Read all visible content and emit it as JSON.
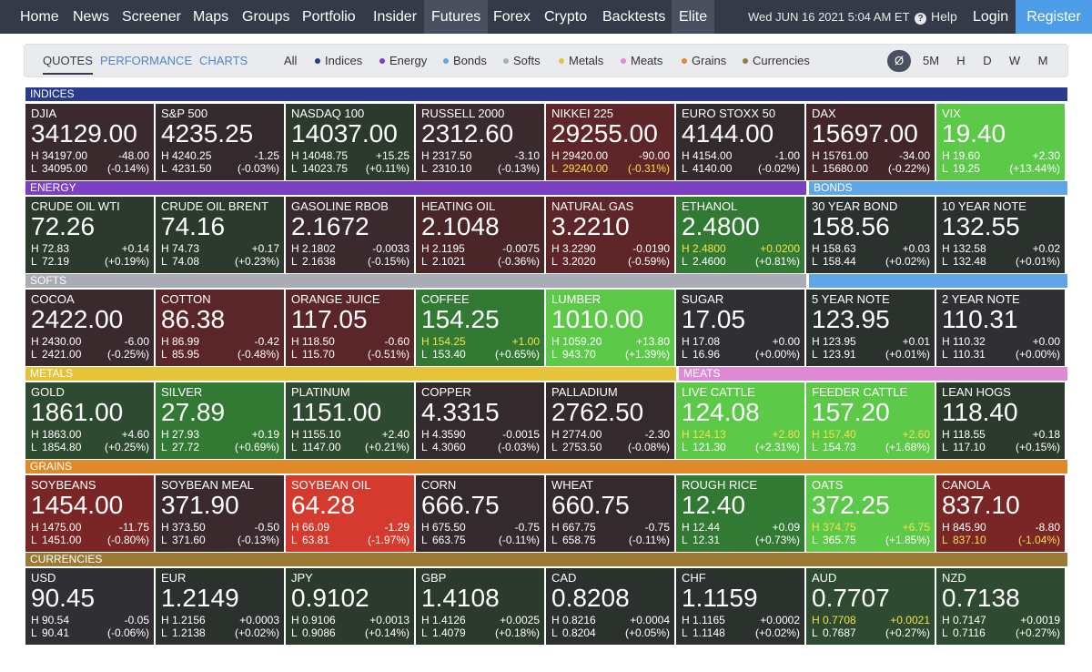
{
  "nav": {
    "items": [
      "Home",
      "News",
      "Screener",
      "Maps",
      "Groups",
      "Portfolio",
      "Insider",
      "Futures",
      "Forex",
      "Crypto",
      "Backtests",
      "Elite"
    ],
    "active": "Futures",
    "datetime": "Wed JUN 16 2021 5:04 AM ET",
    "help": "Help",
    "login": "Login",
    "register": "Register"
  },
  "subnav": {
    "tabs": [
      "QUOTES",
      "PERFORMANCE",
      "CHARTS"
    ],
    "active_tab": "QUOTES",
    "filters": [
      {
        "label": "All",
        "color": ""
      },
      {
        "label": "Indices",
        "color": "#2a3a8c"
      },
      {
        "label": "Energy",
        "color": "#7b3fc4"
      },
      {
        "label": "Bonds",
        "color": "#5ea6e8"
      },
      {
        "label": "Softs",
        "color": "#a9acb4"
      },
      {
        "label": "Metals",
        "color": "#e6c43a"
      },
      {
        "label": "Meats",
        "color": "#e08ad6"
      },
      {
        "label": "Grains",
        "color": "#e0892a"
      },
      {
        "label": "Currencies",
        "color": "#9a7a35"
      }
    ],
    "periods": [
      "Ø",
      "5M",
      "H",
      "D",
      "W",
      "M"
    ],
    "active_period": "Ø"
  },
  "sections": {
    "indices": {
      "label": "INDICES",
      "color": "#2a3a8c"
    },
    "energy": {
      "label": "ENERGY",
      "color": "#7b3fc4"
    },
    "bonds": {
      "label": "BONDS",
      "color": "#5ea6e8"
    },
    "softs": {
      "label": "SOFTS",
      "color": "#a9acb4"
    },
    "softs_bonds": {
      "label": "",
      "color": "#5ea6e8"
    },
    "metals": {
      "label": "METALS",
      "color": "#e6c43a"
    },
    "meats": {
      "label": "MEATS",
      "color": "#e08ad6"
    },
    "grains": {
      "label": "GRAINS",
      "color": "#e0892a"
    },
    "currencies": {
      "label": "CURRENCIES",
      "color": "#9a7a35"
    }
  },
  "tiles": [
    {
      "name": "DJIA",
      "price": "34129.00",
      "high": "34197.00",
      "low": "34095.00",
      "change": "-48.00",
      "pct": "(-0.14%)",
      "bg": "#3a2a2d",
      "hi": ""
    },
    {
      "name": "S&P 500",
      "price": "4235.25",
      "high": "4240.25",
      "low": "4231.50",
      "change": "-1.25",
      "pct": "(-0.03%)",
      "bg": "#34292d",
      "hi": ""
    },
    {
      "name": "NASDAQ 100",
      "price": "14037.00",
      "high": "14048.75",
      "low": "14023.75",
      "change": "+15.25",
      "pct": "(+0.11%)",
      "bg": "#2c3a2e",
      "hi": ""
    },
    {
      "name": "RUSSELL 2000",
      "price": "2312.60",
      "high": "2317.50",
      "low": "2310.10",
      "change": "-3.10",
      "pct": "(-0.13%)",
      "bg": "#3a2a2d",
      "hi": ""
    },
    {
      "name": "NIKKEI 225",
      "price": "29255.00",
      "high": "29420.00",
      "low": "29240.00",
      "change": "-90.00",
      "pct": "(-0.31%)",
      "bg": "#5e2628",
      "hi": "low"
    },
    {
      "name": "EURO STOXX 50",
      "price": "4144.00",
      "high": "4154.00",
      "low": "4140.00",
      "change": "-1.00",
      "pct": "(-0.02%)",
      "bg": "#322a2d",
      "hi": ""
    },
    {
      "name": "DAX",
      "price": "15697.00",
      "high": "15761.00",
      "low": "15680.00",
      "change": "-34.00",
      "pct": "(-0.22%)",
      "bg": "#422629",
      "hi": ""
    },
    {
      "name": "VIX",
      "price": "19.40",
      "high": "19.60",
      "low": "19.25",
      "change": "+2.30",
      "pct": "(+13.44%)",
      "bg": "#5cc949",
      "hi": ""
    },
    {
      "name": "CRUDE OIL WTI",
      "price": "72.26",
      "high": "72.83",
      "low": "72.19",
      "change": "+0.14",
      "pct": "(+0.19%)",
      "bg": "#2c3a2e",
      "hi": ""
    },
    {
      "name": "CRUDE OIL BRENT",
      "price": "74.16",
      "high": "74.73",
      "low": "74.08",
      "change": "+0.17",
      "pct": "(+0.23%)",
      "bg": "#2c3a2e",
      "hi": ""
    },
    {
      "name": "GASOLINE RBOB",
      "price": "2.1672",
      "high": "2.1802",
      "low": "2.1638",
      "change": "-0.0033",
      "pct": "(-0.15%)",
      "bg": "#3a2a2d",
      "hi": ""
    },
    {
      "name": "HEATING OIL",
      "price": "2.1048",
      "high": "2.1195",
      "low": "2.1021",
      "change": "-0.0075",
      "pct": "(-0.36%)",
      "bg": "#4a2629",
      "hi": ""
    },
    {
      "name": "NATURAL GAS",
      "price": "3.2210",
      "high": "3.2290",
      "low": "3.2020",
      "change": "-0.0190",
      "pct": "(-0.59%)",
      "bg": "#5e2628",
      "hi": ""
    },
    {
      "name": "ETHANOL",
      "price": "2.4800",
      "high": "2.4800",
      "low": "2.4600",
      "change": "+0.0200",
      "pct": "(+0.81%)",
      "bg": "#327a33",
      "hi": "high"
    },
    {
      "name": "30 YEAR BOND",
      "price": "158.56",
      "high": "158.63",
      "low": "158.44",
      "change": "+0.03",
      "pct": "(+0.02%)",
      "bg": "#2b312d",
      "hi": ""
    },
    {
      "name": "10 YEAR NOTE",
      "price": "132.55",
      "high": "132.58",
      "low": "132.48",
      "change": "+0.02",
      "pct": "(+0.01%)",
      "bg": "#2b312d",
      "hi": ""
    },
    {
      "name": "COCOA",
      "price": "2422.00",
      "high": "2430.00",
      "low": "2421.00",
      "change": "-6.00",
      "pct": "(-0.25%)",
      "bg": "#3a2a2d",
      "hi": ""
    },
    {
      "name": "COTTON",
      "price": "86.38",
      "high": "86.99",
      "low": "85.95",
      "change": "-0.42",
      "pct": "(-0.48%)",
      "bg": "#5a2629",
      "hi": ""
    },
    {
      "name": "ORANGE JUICE",
      "price": "117.05",
      "high": "118.50",
      "low": "115.70",
      "change": "-0.60",
      "pct": "(-0.51%)",
      "bg": "#5a2629",
      "hi": ""
    },
    {
      "name": "COFFEE",
      "price": "154.25",
      "high": "154.25",
      "low": "153.40",
      "change": "+1.00",
      "pct": "(+0.65%)",
      "bg": "#327a33",
      "hi": "high"
    },
    {
      "name": "LUMBER",
      "price": "1010.00",
      "high": "1059.20",
      "low": "943.70",
      "change": "+13.80",
      "pct": "(+1.39%)",
      "bg": "#5cc949",
      "hi": ""
    },
    {
      "name": "SUGAR",
      "price": "17.05",
      "high": "17.08",
      "low": "16.96",
      "change": "+0.00",
      "pct": "(+0.00%)",
      "bg": "#303034",
      "hi": ""
    },
    {
      "name": "5 YEAR NOTE",
      "price": "123.95",
      "high": "123.95",
      "low": "123.91",
      "change": "+0.01",
      "pct": "(+0.01%)",
      "bg": "#2b312d",
      "hi": ""
    },
    {
      "name": "2 YEAR NOTE",
      "price": "110.31",
      "high": "110.32",
      "low": "110.31",
      "change": "+0.00",
      "pct": "(+0.00%)",
      "bg": "#303034",
      "hi": ""
    },
    {
      "name": "GOLD",
      "price": "1861.00",
      "high": "1863.00",
      "low": "1854.80",
      "change": "+4.60",
      "pct": "(+0.25%)",
      "bg": "#2e4a30",
      "hi": ""
    },
    {
      "name": "SILVER",
      "price": "27.89",
      "high": "27.93",
      "low": "27.72",
      "change": "+0.19",
      "pct": "(+0.69%)",
      "bg": "#327a33",
      "hi": ""
    },
    {
      "name": "PLATINUM",
      "price": "1151.00",
      "high": "1155.10",
      "low": "1147.00",
      "change": "+2.40",
      "pct": "(+0.21%)",
      "bg": "#2e4a30",
      "hi": ""
    },
    {
      "name": "COPPER",
      "price": "4.3315",
      "high": "4.3590",
      "low": "4.3060",
      "change": "-0.0015",
      "pct": "(-0.03%)",
      "bg": "#34292d",
      "hi": ""
    },
    {
      "name": "PALLADIUM",
      "price": "2762.50",
      "high": "2774.00",
      "low": "2753.50",
      "change": "-2.30",
      "pct": "(-0.08%)",
      "bg": "#34292d",
      "hi": ""
    },
    {
      "name": "LIVE CATTLE",
      "price": "124.08",
      "high": "124.13",
      "low": "121.30",
      "change": "+2.80",
      "pct": "(+2.31%)",
      "bg": "#5cc949",
      "hi": "high"
    },
    {
      "name": "FEEDER CATTLE",
      "price": "157.20",
      "high": "157.40",
      "low": "154.73",
      "change": "+2.60",
      "pct": "(+1.68%)",
      "bg": "#5cc949",
      "hi": "high"
    },
    {
      "name": "LEAN HOGS",
      "price": "118.40",
      "high": "118.55",
      "low": "117.10",
      "change": "+0.18",
      "pct": "(+0.15%)",
      "bg": "#2c3a2e",
      "hi": ""
    },
    {
      "name": "SOYBEANS",
      "price": "1454.00",
      "high": "1475.00",
      "low": "1451.00",
      "change": "-11.75",
      "pct": "(-0.80%)",
      "bg": "#7a2626",
      "hi": ""
    },
    {
      "name": "SOYBEAN MEAL",
      "price": "371.90",
      "high": "373.50",
      "low": "371.60",
      "change": "-0.50",
      "pct": "(-0.13%)",
      "bg": "#3a2a2d",
      "hi": ""
    },
    {
      "name": "SOYBEAN OIL",
      "price": "64.28",
      "high": "66.09",
      "low": "63.81",
      "change": "-1.29",
      "pct": "(-1.97%)",
      "bg": "#d43a2e",
      "hi": ""
    },
    {
      "name": "CORN",
      "price": "666.75",
      "high": "675.50",
      "low": "663.75",
      "change": "-0.75",
      "pct": "(-0.11%)",
      "bg": "#34292d",
      "hi": ""
    },
    {
      "name": "WHEAT",
      "price": "660.75",
      "high": "667.75",
      "low": "658.75",
      "change": "-0.75",
      "pct": "(-0.11%)",
      "bg": "#34292d",
      "hi": ""
    },
    {
      "name": "ROUGH RICE",
      "price": "12.40",
      "high": "12.44",
      "low": "12.31",
      "change": "+0.09",
      "pct": "(+0.73%)",
      "bg": "#327a33",
      "hi": ""
    },
    {
      "name": "OATS",
      "price": "372.25",
      "high": "374.75",
      "low": "365.75",
      "change": "+6.75",
      "pct": "(+1.85%)",
      "bg": "#5cc949",
      "hi": "high"
    },
    {
      "name": "CANOLA",
      "price": "837.10",
      "high": "845.90",
      "low": "837.10",
      "change": "-8.80",
      "pct": "(-1.04%)",
      "bg": "#7a2626",
      "hi": "low"
    },
    {
      "name": "USD",
      "price": "90.45",
      "high": "90.54",
      "low": "90.41",
      "change": "-0.05",
      "pct": "(-0.06%)",
      "bg": "#303034",
      "hi": ""
    },
    {
      "name": "EUR",
      "price": "1.2149",
      "high": "1.2156",
      "low": "1.2138",
      "change": "+0.0003",
      "pct": "(+0.02%)",
      "bg": "#2b312d",
      "hi": ""
    },
    {
      "name": "JPY",
      "price": "0.9102",
      "high": "0.9106",
      "low": "0.9086",
      "change": "+0.0013",
      "pct": "(+0.14%)",
      "bg": "#2c3a2e",
      "hi": ""
    },
    {
      "name": "GBP",
      "price": "1.4108",
      "high": "1.4126",
      "low": "1.4079",
      "change": "+0.0025",
      "pct": "(+0.18%)",
      "bg": "#2c3a2e",
      "hi": ""
    },
    {
      "name": "CAD",
      "price": "0.8208",
      "high": "0.8216",
      "low": "0.8204",
      "change": "+0.0004",
      "pct": "(+0.05%)",
      "bg": "#2b312d",
      "hi": ""
    },
    {
      "name": "CHF",
      "price": "1.1159",
      "high": "1.1165",
      "low": "1.1148",
      "change": "+0.0002",
      "pct": "(+0.02%)",
      "bg": "#2b312d",
      "hi": ""
    },
    {
      "name": "AUD",
      "price": "0.7707",
      "high": "0.7708",
      "low": "0.7687",
      "change": "+0.0021",
      "pct": "(+0.27%)",
      "bg": "#2e4a30",
      "hi": "high"
    },
    {
      "name": "NZD",
      "price": "0.7138",
      "high": "0.7147",
      "low": "0.7116",
      "change": "+0.0019",
      "pct": "(+0.27%)",
      "bg": "#2e4a30",
      "hi": ""
    }
  ]
}
